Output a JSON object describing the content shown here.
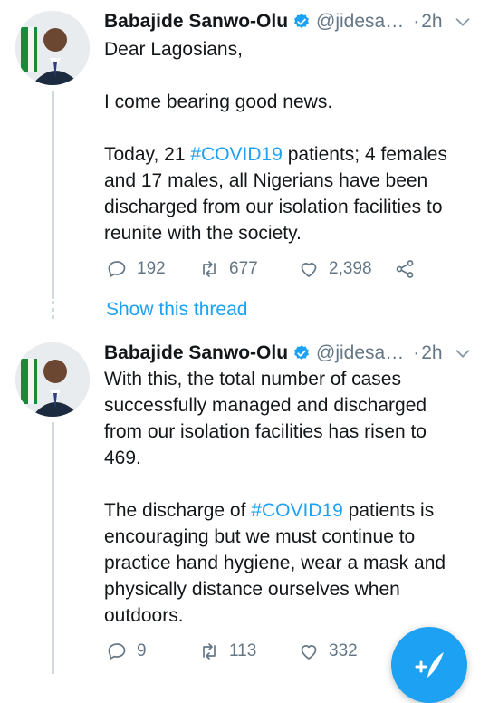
{
  "tweets": [
    {
      "author": "Babajide Sanwo-Olu",
      "handle": "@jidesa…",
      "separator": "·",
      "time": "2h",
      "body": {
        "l1": "Dear Lagosians,",
        "l2": "I come bearing good news.",
        "l3a": "Today, 21 ",
        "l3h": "#COVID19",
        "l3b": " patients; 4 females",
        "l4": "and 17 males, all Nigerians have been",
        "l5": "discharged from our isolation facilities to",
        "l6": "reunite with the society."
      },
      "replies": "192",
      "retweets": "677",
      "likes": "2,398"
    },
    {
      "author": "Babajide Sanwo-Olu",
      "handle": "@jidesa…",
      "separator": "·",
      "time": "2h",
      "body": {
        "l1": "With this, the total number of cases",
        "l2": "successfully managed and discharged",
        "l3": "from our isolation facilities has risen to",
        "l4": "469.",
        "l5a": "The discharge of ",
        "l5h": "#COVID19",
        "l5b": " patients is",
        "l6": "encouraging but we must continue to",
        "l7": "practice hand hygiene, wear a mask and",
        "l8": "physically distance ourselves when",
        "l9": "outdoors."
      },
      "replies": "9",
      "retweets": "113",
      "likes": "332"
    }
  ],
  "show_thread": "Show this thread",
  "colors": {
    "accent": "#1da1f2",
    "muted": "#657786",
    "text": "#14171a",
    "line": "#cfd9de"
  },
  "icons": [
    "verified-badge-icon",
    "chevron-down-icon",
    "reply-icon",
    "retweet-icon",
    "like-icon",
    "share-icon",
    "compose-icon"
  ]
}
